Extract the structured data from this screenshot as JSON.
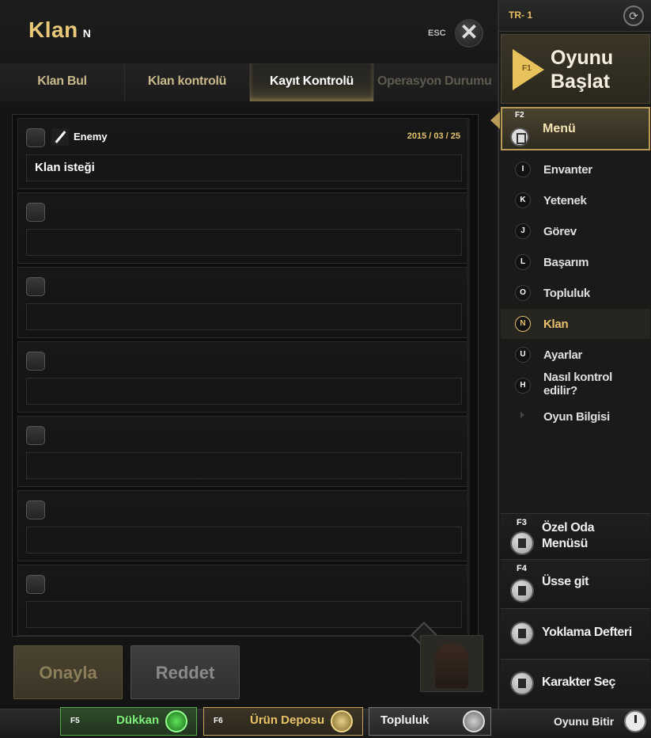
{
  "panel": {
    "title": "Klan",
    "title_hotkey": "N",
    "esc_label": "ESC"
  },
  "tabs": [
    {
      "label": "Klan Bul"
    },
    {
      "label": "Klan kontrolü"
    },
    {
      "label": "Kayıt Kontrolü",
      "active": true
    },
    {
      "label": "Operasyon Durumu"
    }
  ],
  "requests": [
    {
      "name": "Enemy",
      "date": "2015 / 03 / 25",
      "message": "Klan isteği"
    },
    {
      "name": "",
      "date": "",
      "message": ""
    },
    {
      "name": "",
      "date": "",
      "message": ""
    },
    {
      "name": "",
      "date": "",
      "message": ""
    },
    {
      "name": "",
      "date": "",
      "message": ""
    },
    {
      "name": "",
      "date": "",
      "message": ""
    },
    {
      "name": "",
      "date": "",
      "message": ""
    }
  ],
  "buttons": {
    "approve": "Onayla",
    "reject": "Reddet"
  },
  "side": {
    "server": "TR- 1",
    "start_key": "F1",
    "start_label_1": "Oyunu",
    "start_label_2": "Başlat",
    "menu_key": "F2",
    "menu_label": "Menü",
    "items": [
      {
        "key": "I",
        "label": "Envanter"
      },
      {
        "key": "K",
        "label": "Yetenek"
      },
      {
        "key": "J",
        "label": "Görev"
      },
      {
        "key": "L",
        "label": "Başarım"
      },
      {
        "key": "O",
        "label": "Topluluk"
      },
      {
        "key": "N",
        "label": "Klan",
        "active": true
      },
      {
        "key": "U",
        "label": "Ayarlar"
      },
      {
        "key": "H",
        "label": "Nasıl kontrol edilir?"
      },
      {
        "key": "",
        "label": "Oyun Bilgisi"
      }
    ],
    "private_room_key": "F3",
    "private_room_label_1": "Özel Oda",
    "private_room_label_2": "Menüsü",
    "base_key": "F4",
    "base_label": "Üsse git",
    "attendance_label": "Yoklama Defteri",
    "character_label": "Karakter Seç"
  },
  "bottom": {
    "shop_key": "F5",
    "shop_label": "Dükkan",
    "depot_key": "F6",
    "depot_label": "Ürün Deposu",
    "community_label": "Topluluk",
    "exit_label": "Oyunu Bitir"
  }
}
